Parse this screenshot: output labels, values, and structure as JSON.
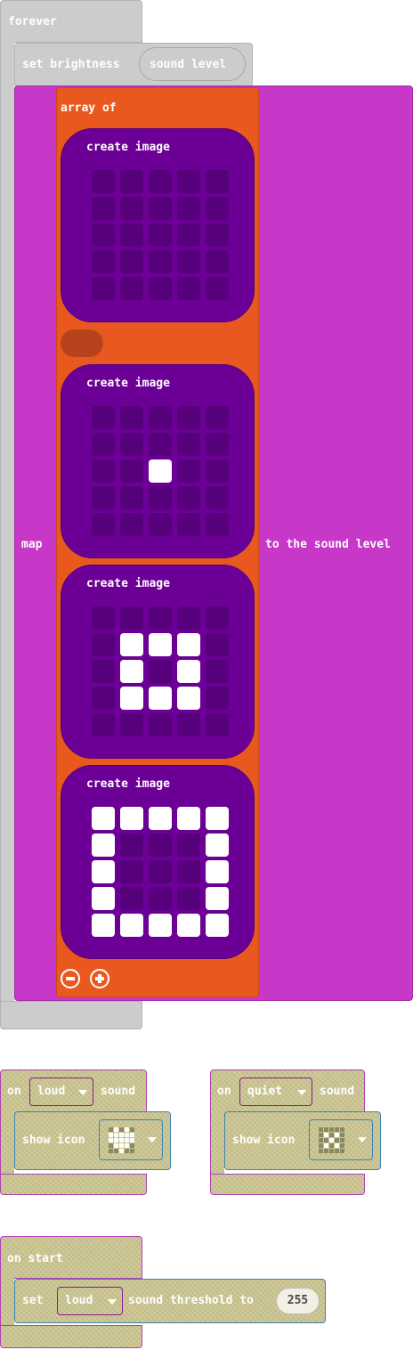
{
  "forever": {
    "label": "forever"
  },
  "set_brightness": {
    "label": "set brightness",
    "value": "sound level"
  },
  "map": {
    "label": "map",
    "to_label": "to the sound level"
  },
  "array": {
    "label": "array of"
  },
  "images": [
    {
      "label": "create image",
      "leds": [
        0,
        0,
        0,
        0,
        0,
        0,
        0,
        0,
        0,
        0,
        0,
        0,
        0,
        0,
        0,
        0,
        0,
        0,
        0,
        0,
        0,
        0,
        0,
        0,
        0
      ]
    },
    {
      "label": "create image",
      "leds": [
        0,
        0,
        0,
        0,
        0,
        0,
        0,
        0,
        0,
        0,
        0,
        0,
        1,
        0,
        0,
        0,
        0,
        0,
        0,
        0,
        0,
        0,
        0,
        0,
        0
      ]
    },
    {
      "label": "create image",
      "leds": [
        0,
        0,
        0,
        0,
        0,
        0,
        1,
        1,
        1,
        0,
        0,
        1,
        0,
        1,
        0,
        0,
        1,
        1,
        1,
        0,
        0,
        0,
        0,
        0,
        0
      ]
    },
    {
      "label": "create image",
      "leds": [
        1,
        1,
        1,
        1,
        1,
        1,
        0,
        0,
        0,
        1,
        1,
        0,
        0,
        0,
        1,
        1,
        0,
        0,
        0,
        1,
        1,
        1,
        1,
        1,
        1
      ]
    }
  ],
  "on_loud": {
    "on_label": "on",
    "dropdown": "loud",
    "sound_label": "sound",
    "show_icon_label": "show icon",
    "icon": [
      0,
      1,
      0,
      1,
      0,
      1,
      1,
      1,
      1,
      1,
      1,
      1,
      1,
      1,
      1,
      0,
      1,
      1,
      1,
      0,
      0,
      0,
      1,
      0,
      0
    ]
  },
  "on_quiet": {
    "on_label": "on",
    "dropdown": "quiet",
    "sound_label": "sound",
    "show_icon_label": "show icon",
    "icon": [
      0,
      0,
      0,
      0,
      0,
      0,
      1,
      0,
      1,
      0,
      0,
      0,
      1,
      0,
      0,
      0,
      1,
      0,
      1,
      0,
      0,
      0,
      0,
      0,
      0
    ]
  },
  "on_start": {
    "label": "on start",
    "set_label": "set",
    "dropdown": "loud",
    "threshold_label": "sound threshold to",
    "value": "255"
  },
  "colors": {
    "loops": "#cccccc",
    "map": "#c738c8",
    "array": "#e9591f",
    "image": "#6c0096",
    "led_on": "#ffffff",
    "led_off": "#56007c"
  }
}
